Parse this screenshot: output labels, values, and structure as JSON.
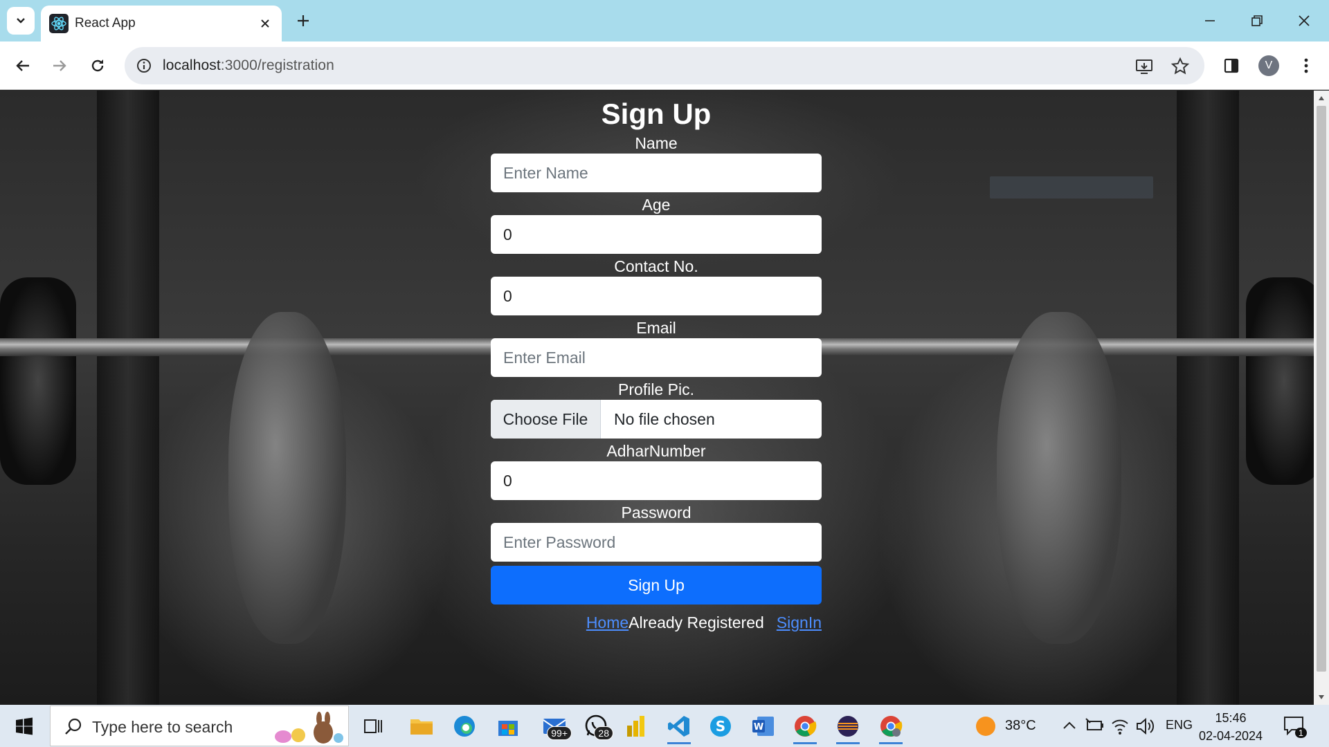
{
  "browser": {
    "tab_title": "React App",
    "url_host": "localhost",
    "url_path": ":3000/registration",
    "profile_initial": "V"
  },
  "form": {
    "title": "Sign Up",
    "name_label": "Name",
    "name_placeholder": "Enter Name",
    "age_label": "Age",
    "age_value": "0",
    "contact_label": "Contact No.",
    "contact_value": "0",
    "email_label": "Email",
    "email_placeholder": "Enter Email",
    "profile_label": "Profile Pic.",
    "file_button": "Choose File",
    "file_status": "No file chosen",
    "adhar_label": "AdharNumber",
    "adhar_value": "0",
    "password_label": "Password",
    "password_placeholder": "Enter Password",
    "submit_label": "Sign Up",
    "home_link": "Home",
    "already_text": "Already Registered",
    "signin_link": "SignIn"
  },
  "taskbar": {
    "search_placeholder": "Type here to search",
    "mail_badge": "99+",
    "whatsapp_badge": "28",
    "weather": "38°C",
    "language": "ENG",
    "time": "15:46",
    "date": "02-04-2024",
    "notification_count": "1"
  },
  "colors": {
    "primary": "#0d6efd",
    "link": "#4d8eff",
    "tabstrip": "#a8dcec"
  }
}
